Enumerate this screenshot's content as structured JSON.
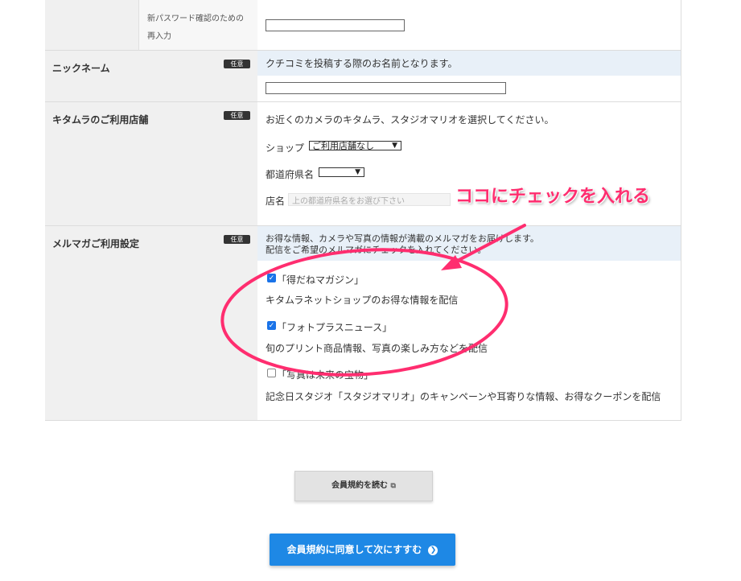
{
  "password_confirm": {
    "label_line1": "新パスワード確認のための",
    "label_line2": "再入力"
  },
  "nickname": {
    "label": "ニックネーム",
    "badge": "任意",
    "note": "クチコミを投稿する際のお名前となります。"
  },
  "store": {
    "label": "キタムラのご利用店舗",
    "badge": "任意",
    "note": "お近くのカメラのキタムラ、スタジオマリオを選択してください。",
    "shop_label": "ショップ",
    "shop_value": "ご利用店舗なし",
    "pref_label": "都道府県名",
    "pref_value": "",
    "name_label": "店名",
    "name_placeholder": "上の都道府県名をお選び下さい"
  },
  "newsletter": {
    "label": "メルマガご利用設定",
    "badge": "任意",
    "note_line1": "お得な情報、カメラや写真の情報が満載のメルマガをお届けします。",
    "note_line2": "配信をご希望のメルマガにチェックを入れてください。",
    "items": [
      {
        "title": "「得だねマガジン」",
        "checked": true,
        "desc": "キタムラネットショップのお得な情報を配信"
      },
      {
        "title": "「フォトプラスニュース」",
        "checked": true,
        "desc": "旬のプリント商品情報、写真の楽しみ方などを配信"
      },
      {
        "title": "「写真は未来の宝物」",
        "checked": false,
        "desc": "記念日スタジオ「スタジオマリオ」のキャンペーンや耳寄りな情報、お得なクーポンを配信"
      }
    ]
  },
  "annotation": {
    "text": "ココにチェックを入れる",
    "color": "#ff2d6f"
  },
  "buttons": {
    "read_terms": "会員規約を読む",
    "agree_next": "会員規約に同意して次にすすむ"
  },
  "colors": {
    "accent": "#1e88e5",
    "highlight": "#ff2d6f"
  }
}
